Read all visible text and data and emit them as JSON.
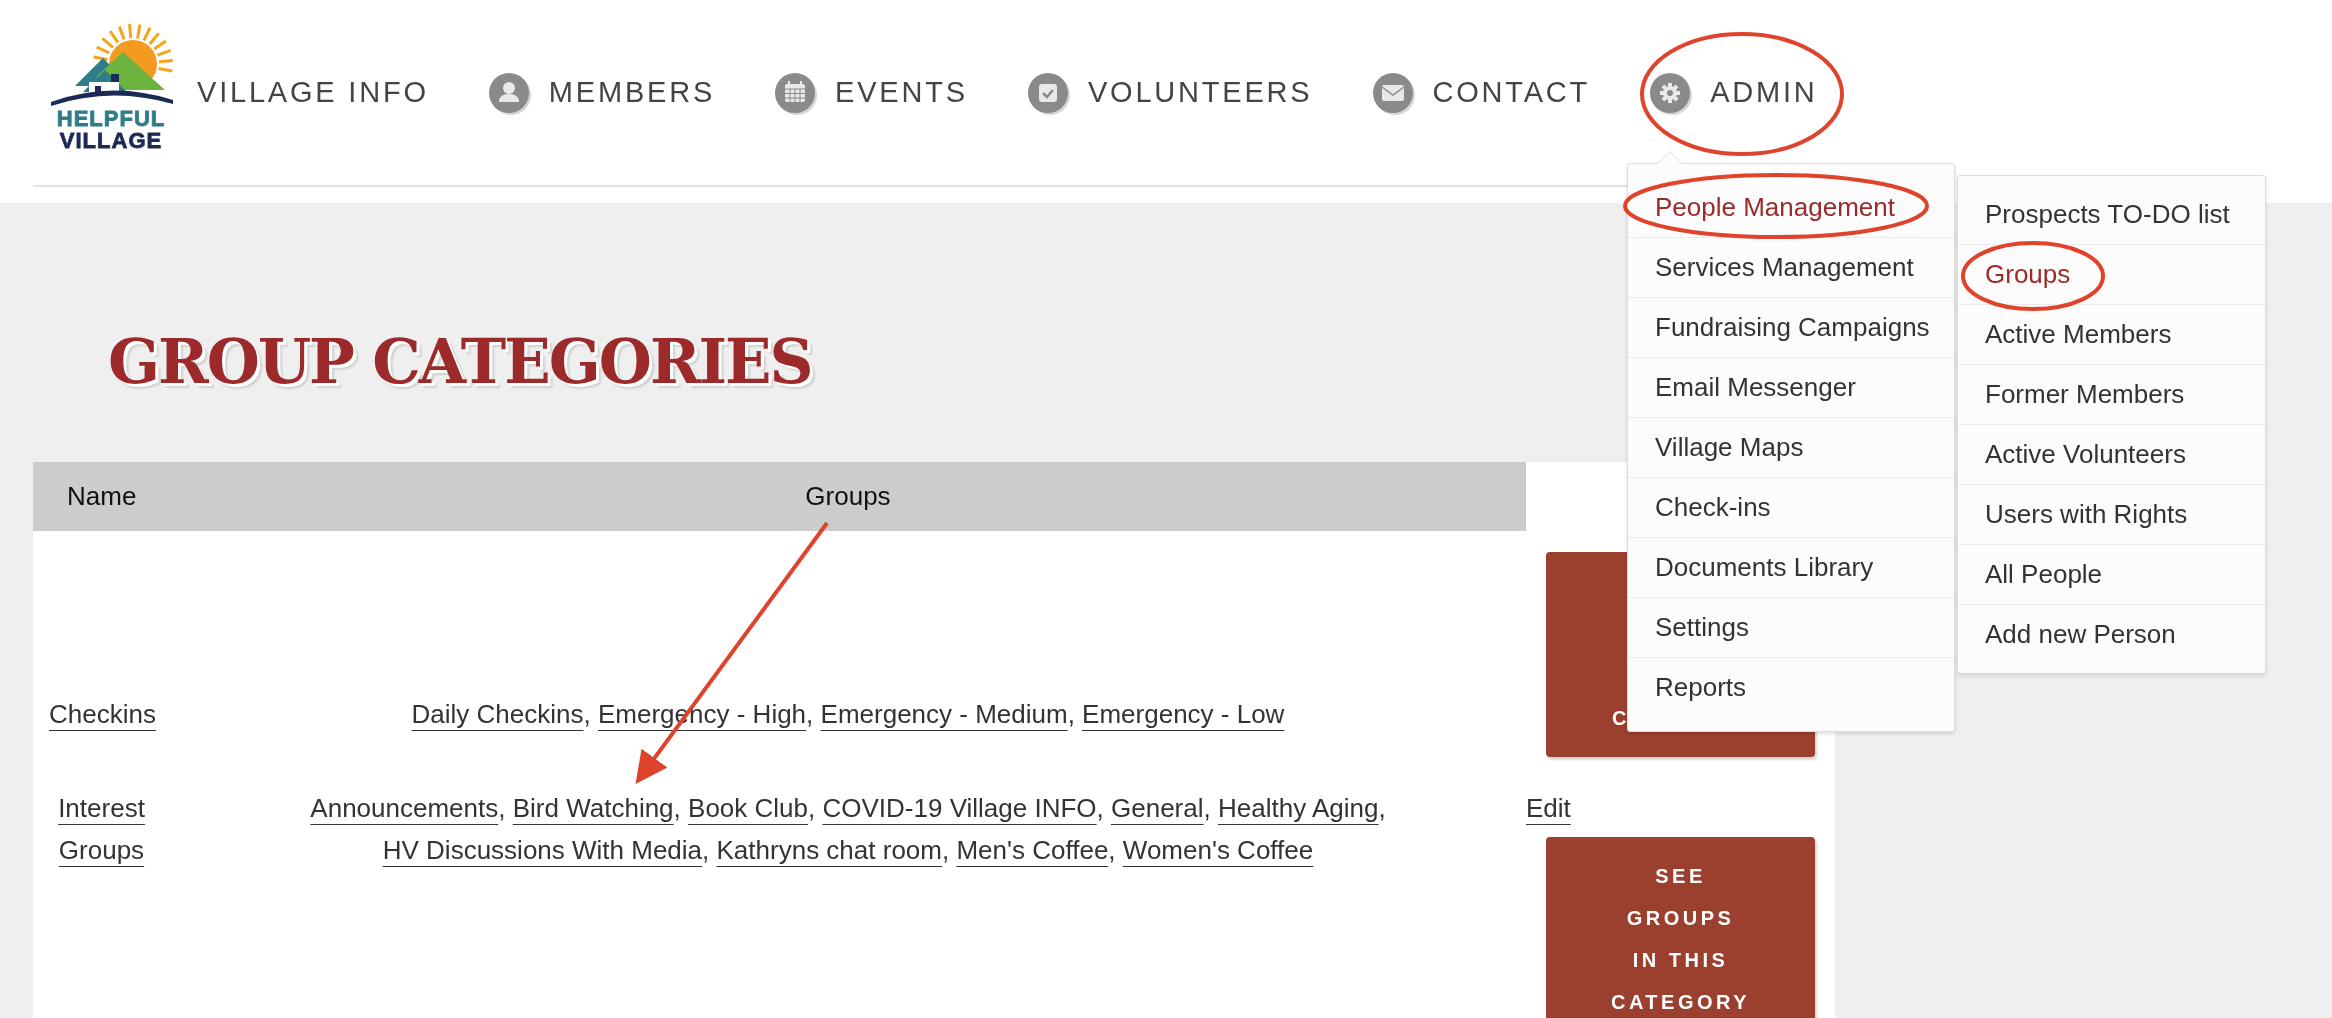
{
  "logo": {
    "line1": "HELPFUL",
    "line2": "VILLAGE"
  },
  "nav": [
    {
      "label": "VILLAGE INFO",
      "kind": "plain"
    },
    {
      "label": "MEMBERS",
      "kind": "person"
    },
    {
      "label": "EVENTS",
      "kind": "calendar"
    },
    {
      "label": "VOLUNTEERS",
      "kind": "check"
    },
    {
      "label": "CONTACT",
      "kind": "envelope"
    },
    {
      "label": "ADMIN",
      "kind": "gear"
    }
  ],
  "admin_menu": {
    "items": [
      {
        "label": "People Management",
        "selected": true
      },
      {
        "label": "Services Management",
        "selected": false
      },
      {
        "label": "Fundraising Campaigns",
        "selected": false
      },
      {
        "label": "Email Messenger",
        "selected": false
      },
      {
        "label": "Village Maps",
        "selected": false
      },
      {
        "label": "Check-ins",
        "selected": false
      },
      {
        "label": "Documents Library",
        "selected": false
      },
      {
        "label": "Settings",
        "selected": false
      },
      {
        "label": "Reports",
        "selected": false
      }
    ]
  },
  "people_submenu": {
    "items": [
      {
        "label": "Prospects TO-DO list",
        "selected": false
      },
      {
        "label": "Groups",
        "selected": true
      },
      {
        "label": "Active Members",
        "selected": false
      },
      {
        "label": "Former Members",
        "selected": false
      },
      {
        "label": "Active Volunteers",
        "selected": false
      },
      {
        "label": "Users with Rights",
        "selected": false
      },
      {
        "label": "All People",
        "selected": false
      },
      {
        "label": "Add new Person",
        "selected": false
      }
    ]
  },
  "title": "GROUP CATEGORIES",
  "table": {
    "columns": [
      "Name",
      "Groups"
    ],
    "rows": [
      {
        "name": "Checkins",
        "groups": [
          {
            "label": "Daily Checkins",
            "suffix": ","
          },
          {
            "label": "Emergency - High",
            "suffix": ","
          },
          {
            "label": "Emergency - Medium",
            "suffix": ","
          },
          {
            "label": "Emergency - Low"
          }
        ],
        "button": [
          "C"
        ]
      },
      {
        "name": "Interest Groups",
        "groups": [
          {
            "label": "Announcements",
            "suffix": ","
          },
          {
            "label": "Bird Watching",
            "suffix": ","
          },
          {
            "label": "Book Club",
            "suffix": ","
          },
          {
            "label": "COVID-19 Village INFO",
            "suffix": ","
          },
          {
            "label": "General",
            "suffix": ","
          },
          {
            "label": "Healthy Aging",
            "suffix": ","
          },
          {
            "label": "HV Discussions With Media",
            "suffix": ","
          },
          {
            "label": "Kathryns chat room",
            "suffix": ","
          },
          {
            "label": "Men's Coffee",
            "suffix": ","
          },
          {
            "label": "Women's Coffee"
          }
        ],
        "edit": "Edit",
        "button": [
          "SEE",
          "GROUPS",
          "IN THIS",
          "CATEGORY"
        ]
      }
    ]
  }
}
